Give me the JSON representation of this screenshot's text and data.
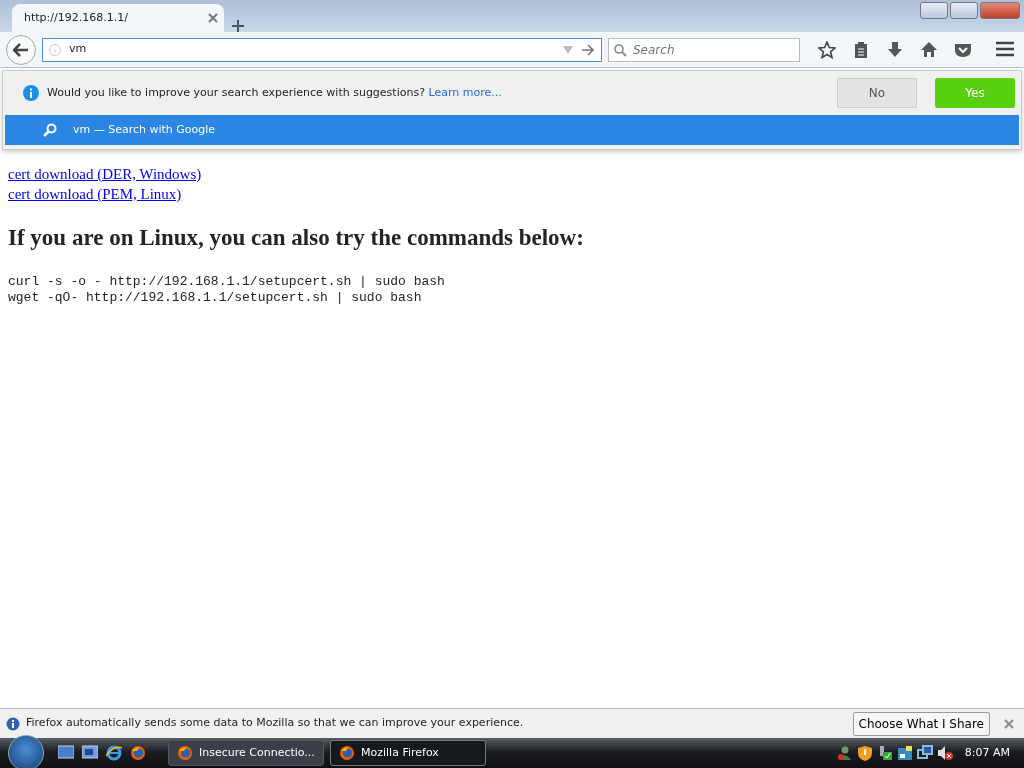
{
  "tabs": [
    {
      "title": "http://192.168.1.1/",
      "selected": true
    }
  ],
  "toolbar": {
    "url": "vm",
    "search_placeholder": "Search"
  },
  "suggestion_popup": {
    "prompt": "Would you like to improve your search experience with suggestions?",
    "link": "Learn more...",
    "buttons": [
      {
        "label": "No",
        "kind": "secondary"
      },
      {
        "label": "Yes",
        "kind": "primary"
      }
    ],
    "result": {
      "query": "vm",
      "separator": "—",
      "action": "Search with Google",
      "selected": true
    }
  },
  "page": {
    "links": [
      "cert download (DER, Windows)",
      "cert download (PEM, Linux)"
    ],
    "heading": "If you are on Linux, you can also try the commands below:",
    "commands": [
      "curl -s -o - http://192.168.1.1/setupcert.sh | sudo bash",
      "wget -qO- http://192.168.1.1/setupcert.sh | sudo bash"
    ]
  },
  "notification": {
    "text": "Firefox automatically sends some data to Mozilla so that we can improve your experience.",
    "button": "Choose What I Share"
  },
  "taskbar": {
    "tasks": [
      {
        "label": "Insecure Connectio...",
        "selected": false
      },
      {
        "label": "Mozilla Firefox",
        "selected": true
      }
    ],
    "clock": "8:07 AM"
  }
}
